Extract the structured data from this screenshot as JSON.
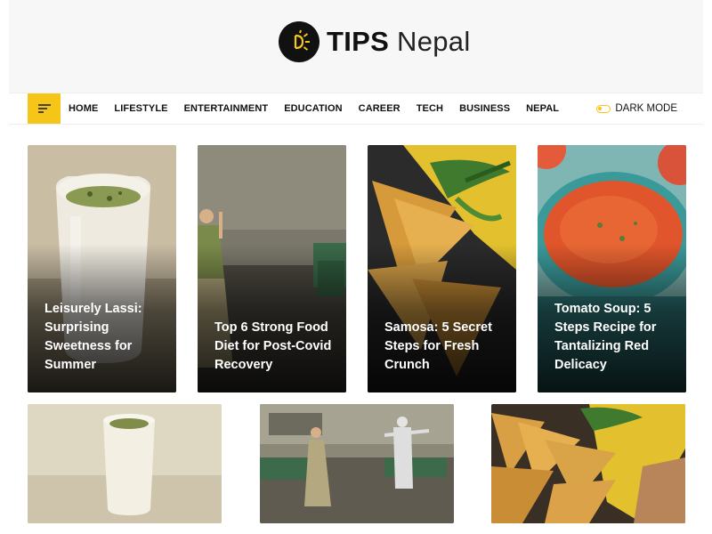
{
  "brand": {
    "name_bold": "TIPS",
    "name_light": "Nepal"
  },
  "nav": {
    "items": [
      "HOME",
      "LIFESTYLE",
      "ENTERTAINMENT",
      "EDUCATION",
      "CAREER",
      "TECH",
      "BUSINESS",
      "NEPAL"
    ],
    "dark_mode_label": "DARK MODE",
    "accent": "#f5c518"
  },
  "featured": [
    {
      "title": "Leisurely Lassi: Surprising Sweetness for Summer"
    },
    {
      "title": "Top 6 Strong Food Diet for Post-Covid Recovery"
    },
    {
      "title": "Samosa: 5 Secret Steps for Fresh Crunch"
    },
    {
      "title": "Tomato Soup: 5 Steps Recipe for Tantalizing Red Delicacy"
    }
  ]
}
